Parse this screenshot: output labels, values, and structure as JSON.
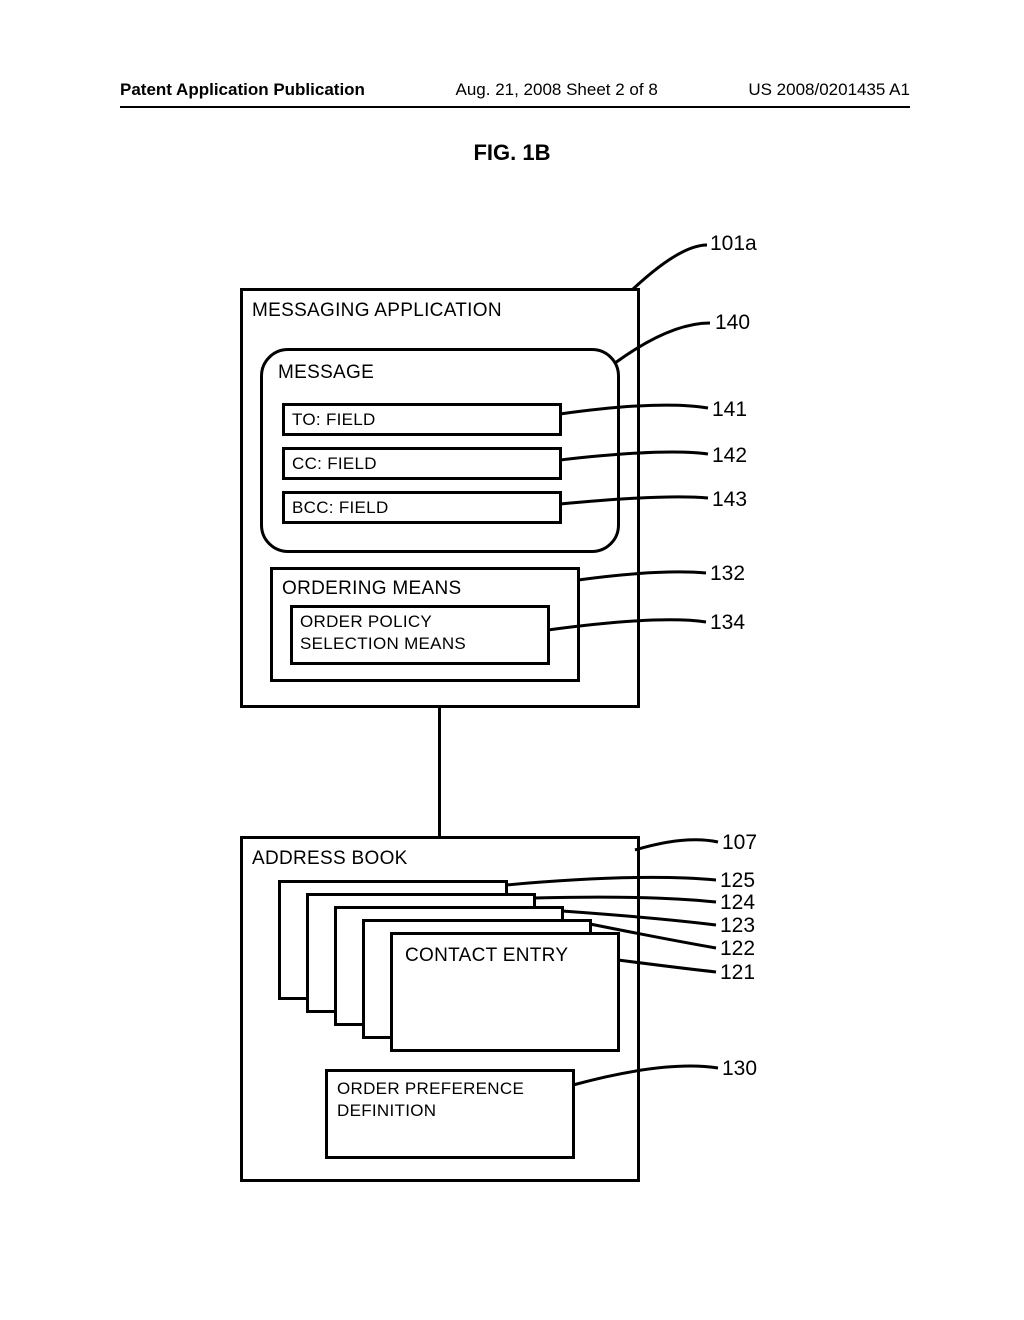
{
  "header": {
    "pub_type": "Patent Application Publication",
    "date_sheet": "Aug. 21, 2008 Sheet 2 of 8",
    "pub_no": "US 2008/0201435 A1"
  },
  "figure": {
    "title": "FIG. 1B"
  },
  "blocks": {
    "messaging_application": "MESSAGING APPLICATION",
    "message": "MESSAGE",
    "to_field": "TO: FIELD",
    "cc_field": "CC: FIELD",
    "bcc_field": "BCC: FIELD",
    "ordering_means": "ORDERING MEANS",
    "order_policy_l1": "ORDER POLICY",
    "order_policy_l2": "SELECTION MEANS",
    "address_book": "ADDRESS BOOK",
    "contact_entry": "CONTACT ENTRY",
    "order_pref_l1": "ORDER PREFERENCE",
    "order_pref_l2": "DEFINITION"
  },
  "refnums": {
    "n101a": "101a",
    "n140": "140",
    "n141": "141",
    "n142": "142",
    "n143": "143",
    "n132": "132",
    "n134": "134",
    "n107": "107",
    "n125": "125",
    "n124": "124",
    "n123": "123",
    "n122": "122",
    "n121": "121",
    "n130": "130"
  }
}
